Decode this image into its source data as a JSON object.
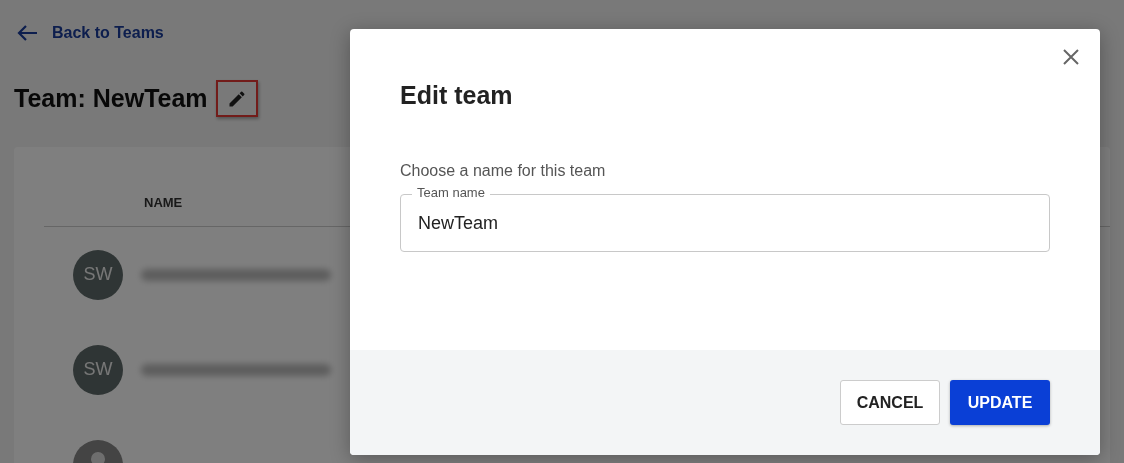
{
  "back_link": {
    "label": "Back to Teams"
  },
  "page_title": "Team: NewTeam",
  "edit_button": {
    "highlighted": true
  },
  "table": {
    "columns": [
      {
        "label": "NAME"
      }
    ],
    "rows": [
      {
        "kind": "initials",
        "initials": "SW"
      },
      {
        "kind": "initials",
        "initials": "SW"
      },
      {
        "kind": "silhouette"
      }
    ]
  },
  "dialog": {
    "title": "Edit team",
    "prompt": "Choose a name for this team",
    "field": {
      "label": "Team name",
      "value": "NewTeam"
    },
    "buttons": [
      {
        "label": "CANCEL",
        "kind": "secondary"
      },
      {
        "label": "UPDATE",
        "kind": "primary"
      }
    ]
  }
}
